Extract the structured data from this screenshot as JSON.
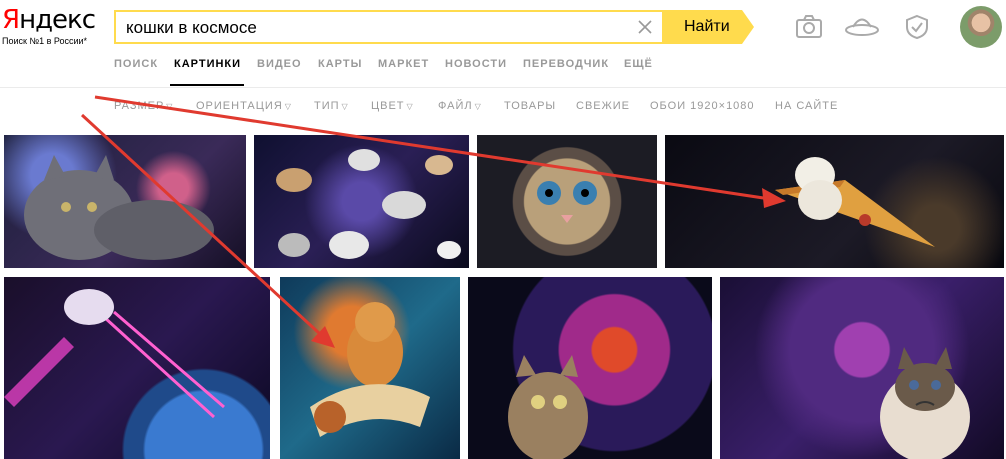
{
  "logo": {
    "first_letter": "Я",
    "rest": "ндекс",
    "tagline": "Поиск №1 в России*"
  },
  "search": {
    "query": "кошки в космосе",
    "button_label": "Найти"
  },
  "header_icons": [
    "camera-icon",
    "ufo-icon",
    "shield-icon"
  ],
  "colors": {
    "search_border": "#ffdb4d",
    "logo_red": "#ff0000",
    "arrow_red": "#e03a2f",
    "tab_inactive": "#999999"
  },
  "tabs": [
    {
      "label": "ПОИСК",
      "active": false
    },
    {
      "label": "КАРТИНКИ",
      "active": true
    },
    {
      "label": "ВИДЕО",
      "active": false
    },
    {
      "label": "КАРТЫ",
      "active": false
    },
    {
      "label": "МАРКЕТ",
      "active": false
    },
    {
      "label": "НОВОСТИ",
      "active": false
    },
    {
      "label": "ПЕРЕВОДЧИК",
      "active": false
    },
    {
      "label": "ЕЩЁ",
      "active": false
    }
  ],
  "filters": [
    {
      "label": "РАЗМЕР",
      "dropdown": true
    },
    {
      "label": "ОРИЕНТАЦИЯ",
      "dropdown": true
    },
    {
      "label": "ТИП",
      "dropdown": true
    },
    {
      "label": "ЦВЕТ",
      "dropdown": true
    },
    {
      "label": "ФАЙЛ",
      "dropdown": true
    },
    {
      "label": "ТОВАРЫ",
      "dropdown": false
    },
    {
      "label": "СВЕЖИЕ",
      "dropdown": false
    },
    {
      "label": "ОБОИ 1920×1080",
      "dropdown": false
    },
    {
      "label": "НА САЙТЕ",
      "dropdown": false
    }
  ],
  "images": [
    "grey-cat-space-image",
    "flying-cats-space-image",
    "astronaut-cat-image",
    "pizza-cat-image",
    "laser-cat-image",
    "burrito-cat-image",
    "nebula-cat-image",
    "grumpy-cat-image"
  ]
}
